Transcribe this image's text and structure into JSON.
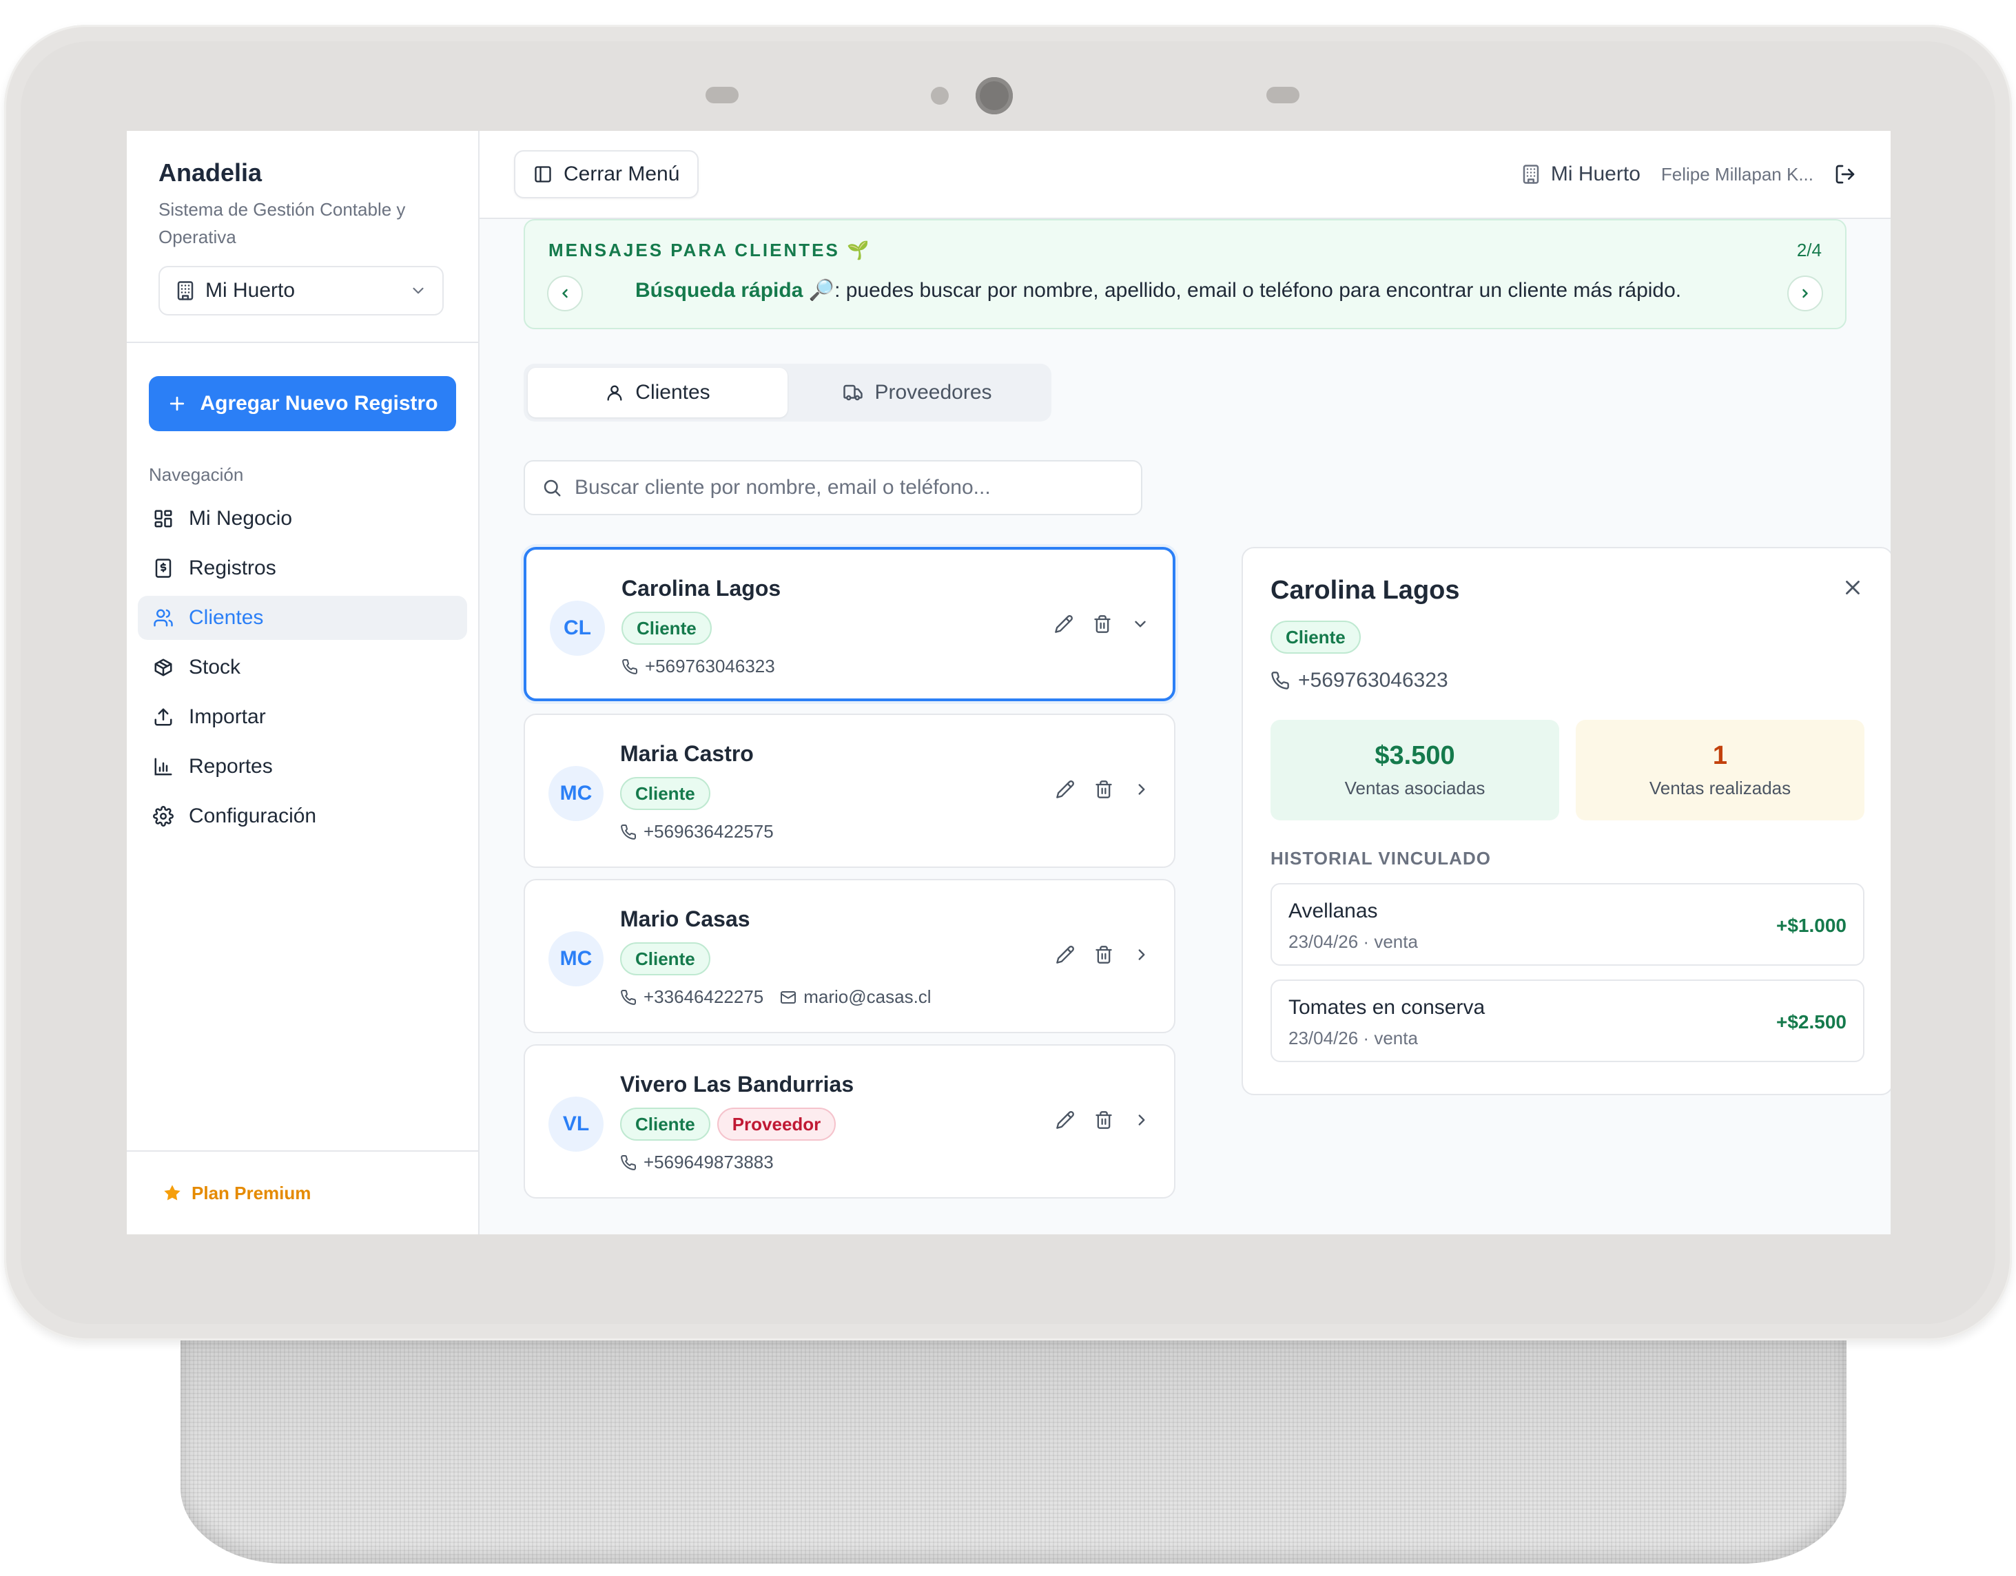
{
  "sidebar": {
    "brand_title": "Anadelia",
    "brand_subtitle": "Sistema de Gestión Contable y Operativa",
    "company_selected": "Mi Huerto",
    "add_button": "Agregar Nuevo Registro",
    "nav_title": "Navegación",
    "items": [
      {
        "label": "Mi Negocio",
        "icon": "grid-icon"
      },
      {
        "label": "Registros",
        "icon": "receipt-icon"
      },
      {
        "label": "Clientes",
        "icon": "users-icon",
        "active": true
      },
      {
        "label": "Stock",
        "icon": "box-icon"
      },
      {
        "label": "Importar",
        "icon": "upload-icon"
      },
      {
        "label": "Reportes",
        "icon": "bar-chart-icon"
      },
      {
        "label": "Configuración",
        "icon": "gear-icon"
      }
    ],
    "plan": "Plan Premium"
  },
  "topbar": {
    "menu_button": "Cerrar Menú",
    "company": "Mi Huerto",
    "user": "Felipe Millapan K..."
  },
  "banner": {
    "title": "MENSAJES PARA CLIENTES 🌱",
    "count": "2/4",
    "bold": "Búsqueda rápida 🔎",
    "text": ": puedes buscar por nombre, apellido, email o teléfono para encontrar un cliente más rápido."
  },
  "tabs": [
    {
      "label": "Clientes",
      "active": true
    },
    {
      "label": "Proveedores",
      "active": false
    }
  ],
  "search": {
    "placeholder": "Buscar cliente por nombre, email o teléfono..."
  },
  "clients": [
    {
      "initials": "CL",
      "name": "Carolina Lagos",
      "badges": [
        "Cliente"
      ],
      "phone": "+569763046323",
      "email": "",
      "selected": true
    },
    {
      "initials": "MC",
      "name": "Maria Castro",
      "badges": [
        "Cliente"
      ],
      "phone": "+569636422575",
      "email": ""
    },
    {
      "initials": "MC",
      "name": "Mario Casas",
      "badges": [
        "Cliente"
      ],
      "phone": "+33646422275",
      "email": "mario@casas.cl"
    },
    {
      "initials": "VL",
      "name": "Vivero Las Bandurrias",
      "badges": [
        "Cliente",
        "Proveedor"
      ],
      "phone": "+569649873883",
      "email": ""
    }
  ],
  "detail": {
    "name": "Carolina Lagos",
    "badge": "Cliente",
    "phone": "+569763046323",
    "stats": [
      {
        "value": "$3.500",
        "label": "Ventas asociadas"
      },
      {
        "value": "1",
        "label": "Ventas realizadas"
      }
    ],
    "history_title": "HISTORIAL VINCULADO",
    "history": [
      {
        "name": "Avellanas",
        "sub": "23/04/26 · venta",
        "amount": "+$1.000"
      },
      {
        "name": "Tomates en conserva",
        "sub": "23/04/26 · venta",
        "amount": "+$2.500"
      }
    ]
  },
  "colors": {
    "accent": "#2b7ff6",
    "success": "#157a4c",
    "danger": "#c01934",
    "premium": "#e58a00"
  }
}
